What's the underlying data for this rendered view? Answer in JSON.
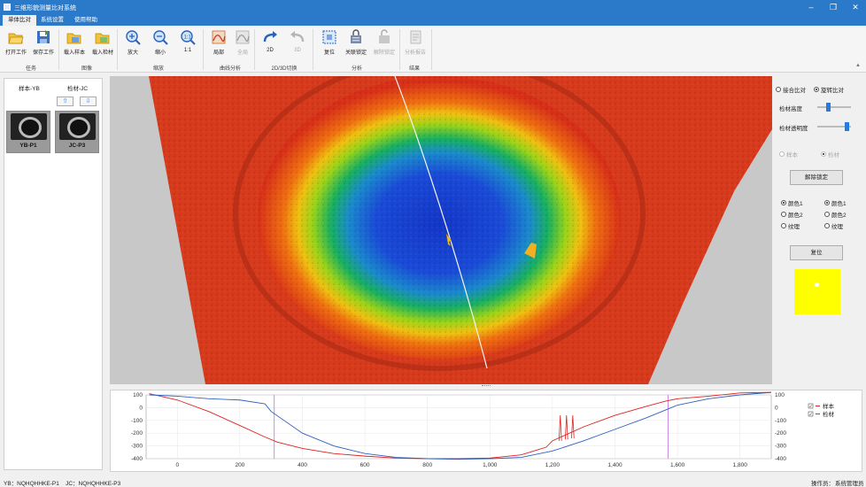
{
  "window": {
    "title": "三维形貌测量比对系统",
    "controls": [
      "–",
      "❐",
      "✕"
    ]
  },
  "menu": {
    "tabs": [
      "单体比对",
      "系统设置",
      "使用帮助"
    ],
    "active": 0
  },
  "ribbon": {
    "buttons": [
      {
        "label": "打开工作",
        "icon": "open-folder-icon",
        "enabled": true
      },
      {
        "label": "保存工作",
        "icon": "save-icon",
        "enabled": true
      },
      {
        "label": "载入样本",
        "icon": "load-sample-icon",
        "enabled": true
      },
      {
        "label": "载入检材",
        "icon": "load-material-icon",
        "enabled": true
      },
      {
        "label": "放大",
        "icon": "zoom-in-icon",
        "enabled": true
      },
      {
        "label": "缩小",
        "icon": "zoom-out-icon",
        "enabled": true
      },
      {
        "label": "1:1",
        "icon": "zoom-actual-icon",
        "enabled": true
      },
      {
        "label": "局部",
        "icon": "local-curve-icon",
        "enabled": true
      },
      {
        "label": "全局",
        "icon": "global-curve-icon",
        "enabled": false
      },
      {
        "label": "2D",
        "icon": "redo-2d-icon",
        "enabled": true
      },
      {
        "label": "3D",
        "icon": "undo-3d-icon",
        "enabled": false
      },
      {
        "label": "复位",
        "icon": "reset-icon",
        "enabled": true
      },
      {
        "label": "关联锁定",
        "icon": "link-lock-icon",
        "enabled": true
      },
      {
        "label": "解除锁定",
        "icon": "unlock-icon",
        "enabled": false
      },
      {
        "label": "分析报告",
        "icon": "report-icon",
        "enabled": false
      }
    ],
    "groups": [
      "任务",
      "图像",
      "缩放",
      "曲线分析",
      "2D/3D切换",
      "分析",
      "结果"
    ]
  },
  "left_panel": {
    "sample_header": "样本-YB",
    "material_header": "检材-JC",
    "up_arrow": "⇧",
    "down_arrow": "⇩",
    "sample_thumb_label": "YB-P1",
    "material_thumb_label": "JC-P3"
  },
  "right_panel": {
    "mode_options": [
      "接合比对",
      "旋转比对"
    ],
    "mode_selected": 1,
    "material_height_label": "检材高度",
    "material_opacity_label": "检材透明度",
    "height_slider_value": 0.3,
    "opacity_slider_value": 0.95,
    "target_options": [
      "样本",
      "检材"
    ],
    "unlock_button": "解除锁定",
    "color_left": [
      "颜色1",
      "颜色2",
      "纹理"
    ],
    "color_right": [
      "颜色1",
      "颜色2",
      "纹理"
    ],
    "reset_button": "复位",
    "swatch_color": "#ffff00"
  },
  "chart_data": {
    "type": "line",
    "xlim": [
      -100,
      1900
    ],
    "ylim_left": [
      -400,
      100
    ],
    "ylim_right": [
      -400,
      100
    ],
    "xticks": [
      0,
      200,
      400,
      600,
      800,
      "1,000",
      "1,200",
      "1,400",
      "1,600",
      "1,800"
    ],
    "yticks_left": [
      100,
      0,
      -100,
      -200,
      -300,
      -400
    ],
    "yticks_right": [
      100,
      0,
      -100,
      -200,
      -300,
      -400
    ],
    "series": [
      {
        "name": "样本",
        "color": "#e02020",
        "x": [
          -90,
          0,
          100,
          200,
          280,
          320,
          400,
          500,
          600,
          700,
          800,
          900,
          1000,
          1100,
          1180,
          1200,
          1300,
          1400,
          1500,
          1560,
          1600,
          1700,
          1800,
          1900
        ],
        "y": [
          110,
          60,
          -30,
          -140,
          -230,
          -270,
          -320,
          -360,
          -380,
          -395,
          -400,
          -400,
          -395,
          -370,
          -310,
          -260,
          -150,
          -60,
          10,
          50,
          70,
          90,
          115,
          120
        ]
      },
      {
        "name": "检材",
        "color": "#3060c0",
        "x": [
          -90,
          0,
          100,
          200,
          280,
          300,
          400,
          500,
          600,
          700,
          800,
          900,
          1000,
          1100,
          1200,
          1300,
          1400,
          1500,
          1560,
          1600,
          1700,
          1800,
          1900
        ],
        "y": [
          100,
          90,
          70,
          60,
          30,
          -30,
          -200,
          -300,
          -360,
          -390,
          -400,
          -405,
          -400,
          -390,
          -340,
          -260,
          -170,
          -80,
          -20,
          20,
          70,
          100,
          120
        ]
      }
    ],
    "markers": [
      310,
      1570
    ],
    "legend": [
      "样本",
      "检材"
    ]
  },
  "status": {
    "left": "YB：NQHQHHKE-P1    JC：NQHQHHKE-P3",
    "right_label": "操作员：",
    "right_value": "系统管理员"
  }
}
